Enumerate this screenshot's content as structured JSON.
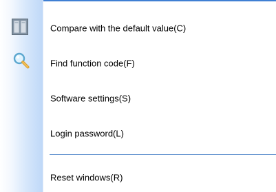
{
  "menu": {
    "items": [
      {
        "label": "Compare with the default value(C)",
        "icon": "compare-columns-icon"
      },
      {
        "label": "Find function code(F)",
        "icon": "magnifier-icon"
      },
      {
        "label": "Software settings(S)",
        "icon": ""
      },
      {
        "label": "Login password(L)",
        "icon": ""
      },
      {
        "label": "Reset windows(R)",
        "icon": ""
      }
    ]
  },
  "colors": {
    "accent": "#3f7fd3",
    "separator": "#6f9bd3",
    "strip": "#bfd8f8",
    "text": "#000000"
  }
}
